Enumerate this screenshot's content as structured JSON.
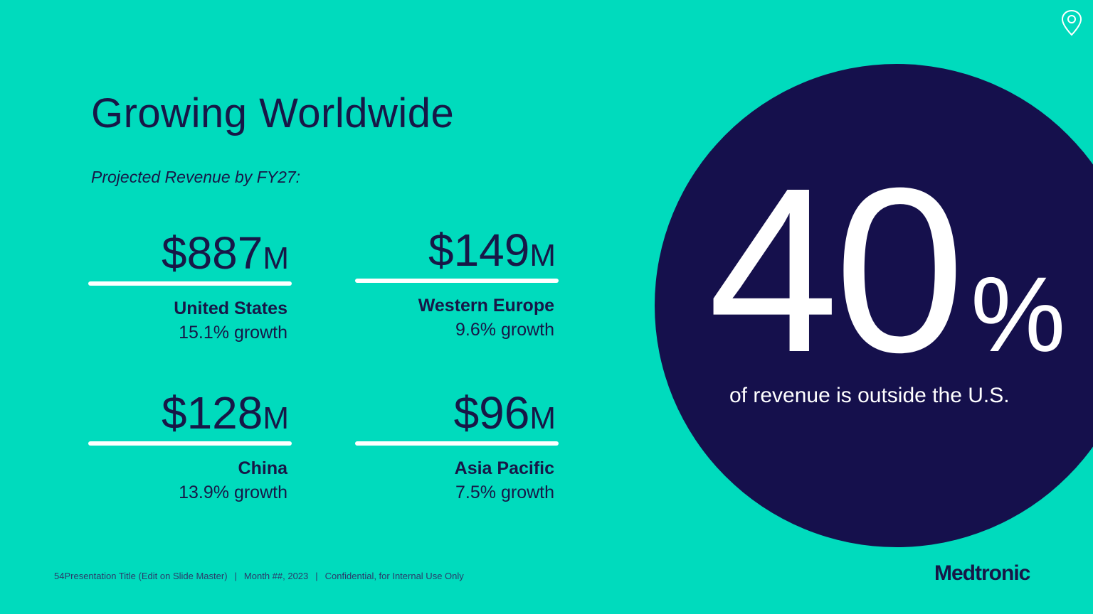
{
  "slide": {
    "title": "Growing Worldwide",
    "subtitle": "Projected Revenue by FY27:"
  },
  "stats": [
    {
      "amount": "$887",
      "unit": "M",
      "region": "United States",
      "growth": "15.1% growth"
    },
    {
      "amount": "$149",
      "unit": "M",
      "region": "Western Europe",
      "growth": "9.6% growth"
    },
    {
      "amount": "$128",
      "unit": "M",
      "region": "China",
      "growth": "13.9% growth"
    },
    {
      "amount": "$96",
      "unit": "M",
      "region": "Asia Pacific",
      "growth": "7.5% growth"
    }
  ],
  "highlight": {
    "number": "40",
    "percent_sign": "%",
    "caption": "of revenue is outside the U.S."
  },
  "footer": {
    "page_number": "54",
    "presentation_title": "Presentation Title (Edit on Slide Master)",
    "separator": "|",
    "date": "Month ##, 2023",
    "confidentiality": "Confidential, for Internal Use Only"
  },
  "brand": {
    "logo_text": "Medtronic",
    "icon": "location-pin-icon"
  },
  "colors": {
    "background": "#00dbbd",
    "navy": "#171747",
    "circle": "#15104c",
    "white": "#ffffff"
  }
}
